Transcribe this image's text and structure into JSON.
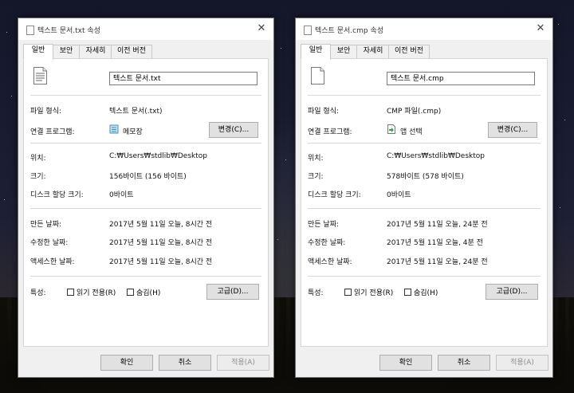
{
  "left_dialog": {
    "title": "텍스트 문서.txt 속성",
    "close_glyph": "✕",
    "tabs": [
      "일반",
      "보안",
      "자세히",
      "이전 버전"
    ],
    "file_name": "텍스트 문서.txt",
    "file_type_label": "파일 형식:",
    "file_type_value": "텍스트 문서(.txt)",
    "opens_with_label": "연결 프로그램:",
    "opens_with_value": "메모장",
    "opens_with_icon": "notepad-icon",
    "change_button": "변경(C)...",
    "location_label": "위치:",
    "location_value": "C:₩Users₩stdlib₩Desktop",
    "size_label": "크기:",
    "size_value": "156바이트 (156 바이트)",
    "size_on_disk_label": "디스크 할당 크기:",
    "size_on_disk_value": "0바이트",
    "created_label": "만든 날짜:",
    "created_value": "2017년 5월 11일 오늘, 8시간 전",
    "modified_label": "수정한 날짜:",
    "modified_value": "2017년 5월 11일 오늘, 8시간 전",
    "accessed_label": "액세스한 날짜:",
    "accessed_value": "2017년 5월 11일 오늘, 8시간 전",
    "attributes_label": "특성:",
    "readonly_label": "읽기 전용(R)",
    "hidden_label": "숨김(H)",
    "advanced_button": "고급(D)...",
    "ok_button": "확인",
    "cancel_button": "취소",
    "apply_button": "적용(A)"
  },
  "right_dialog": {
    "title": "텍스트 문서.cmp 속성",
    "close_glyph": "✕",
    "tabs": [
      "일반",
      "보안",
      "자세히",
      "이전 버전"
    ],
    "file_name": "텍스트 문서.cmp",
    "file_type_label": "파일 형식:",
    "file_type_value": "CMP 파일(.cmp)",
    "opens_with_label": "연결 프로그램:",
    "opens_with_value": "앱 선택",
    "opens_with_icon": "choose-app-icon",
    "change_button": "변경(C)...",
    "location_label": "위치:",
    "location_value": "C:₩Users₩stdlib₩Desktop",
    "size_label": "크기:",
    "size_value": "578바이트 (578 바이트)",
    "size_on_disk_label": "디스크 할당 크기:",
    "size_on_disk_value": "0바이트",
    "created_label": "만든 날짜:",
    "created_value": "2017년 5월 11일 오늘, 24분 전",
    "modified_label": "수정한 날짜:",
    "modified_value": "2017년 5월 11일 오늘, 4분 전",
    "accessed_label": "액세스한 날짜:",
    "accessed_value": "2017년 5월 11일 오늘, 24분 전",
    "attributes_label": "특성:",
    "readonly_label": "읽기 전용(R)",
    "hidden_label": "숨김(H)",
    "advanced_button": "고급(D)...",
    "ok_button": "확인",
    "cancel_button": "취소",
    "apply_button": "적용(A)"
  }
}
